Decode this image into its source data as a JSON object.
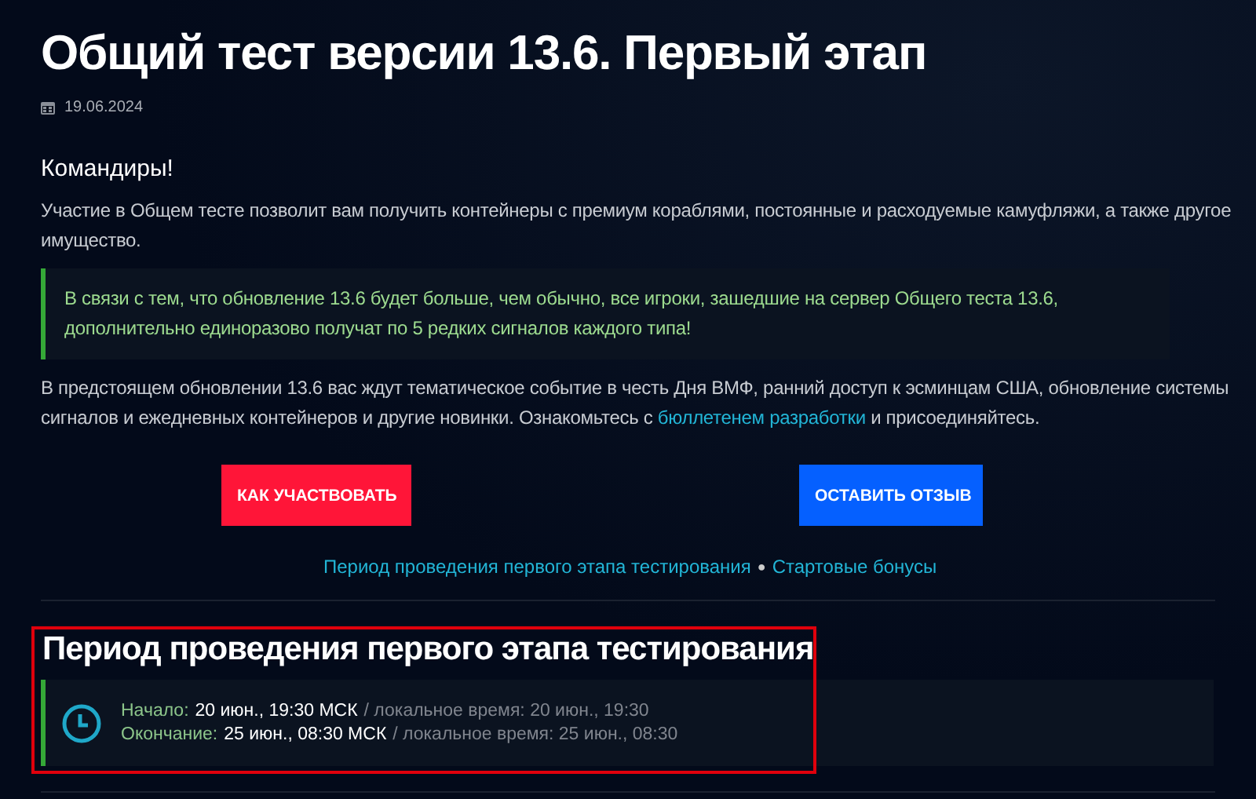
{
  "title": "Общий тест версии 13.6. Первый этап",
  "date": "19.06.2024",
  "greeting": "Командиры!",
  "intro": "Участие в Общем тесте позволит вам получить контейнеры с премиум кораблями, постоянные и расходуемые камуфляжи, а также другое имущество.",
  "notice": "В связи с тем, что обновление 13.6 будет больше, чем обычно, все игроки, зашедшие на сервер Общего теста 13.6, дополнительно единоразово получат по 5 редких сигналов каждого типа!",
  "body": {
    "before": "В предстоящем обновлении 13.6 вас ждут тематическое событие в честь Дня ВМФ, ранний доступ к эсминцам США, обновление системы сигналов и ежедневных контейнеров и другие новинки. Ознакомьтесь с",
    "link": "бюллетенем разработки",
    "after": "и присоединяйтесь."
  },
  "buttons": [
    {
      "label": "КАК УЧАСТВОВАТЬ",
      "kind": "primary"
    },
    {
      "label": "ОСТАВИТЬ ОТЗЫВ",
      "kind": "secondary"
    }
  ],
  "anchors": [
    {
      "label": "Период проведения первого этапа тестирования"
    },
    {
      "label": "Стартовые бонусы"
    }
  ],
  "anchor_separator": "●",
  "section": {
    "heading": "Период проведения первого этапа тестирования",
    "highlighted": true,
    "times": [
      {
        "label": "Начало:",
        "value": "20 июн., 19:30 МСК",
        "local": "/ локальное время: 20 июн., 19:30"
      },
      {
        "label": "Окончание:",
        "value": "25 июн., 08:30 МСК",
        "local": "/ локальное время: 25 июн., 08:30"
      }
    ]
  }
}
